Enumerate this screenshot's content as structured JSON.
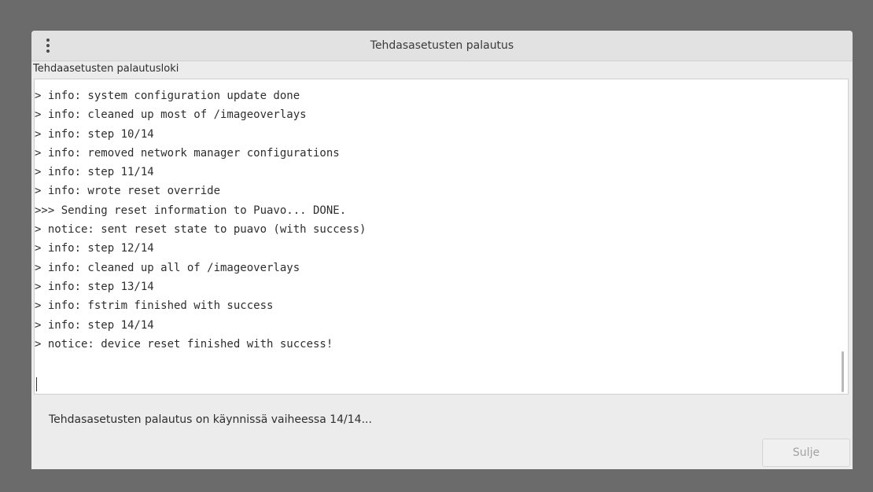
{
  "window": {
    "title": "Tehdasasetusten palautus",
    "menu_icon": "vertical-dots-icon"
  },
  "log": {
    "label": "Tehdaasetusten palautusloki",
    "lines": [
      "> info: system configuration update done",
      "> info: cleaned up most of /imageoverlays",
      "> info: step 10/14",
      "> info: removed network manager configurations",
      "> info: step 11/14",
      "> info: wrote reset override",
      ">>> Sending reset information to Puavo... DONE.",
      "> notice: sent reset state to puavo (with success)",
      "> info: step 12/14",
      "> info: cleaned up all of /imageoverlays",
      "> info: step 13/14",
      "> info: fstrim finished with success",
      "> info: step 14/14",
      "> notice: device reset finished with success!"
    ]
  },
  "status": {
    "text": "Tehdasasetusten palautus on käynnissä vaiheessa 14/14..."
  },
  "buttons": {
    "close_label": "Sulje"
  }
}
